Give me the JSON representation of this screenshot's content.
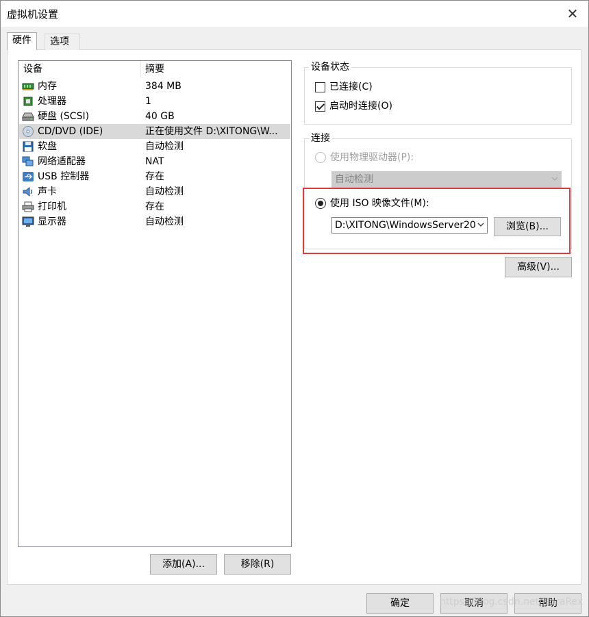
{
  "window": {
    "title": "虚拟机设置",
    "close": "✕"
  },
  "tabs": [
    {
      "label": "硬件",
      "active": true
    },
    {
      "label": "选项",
      "active": false
    }
  ],
  "device_list": {
    "headers": [
      "设备",
      "摘要"
    ],
    "rows": [
      {
        "icon": "memory-icon",
        "name": "内存",
        "summary": "384 MB"
      },
      {
        "icon": "processor-icon",
        "name": "处理器",
        "summary": "1"
      },
      {
        "icon": "hard-disk-icon",
        "name": "硬盘 (SCSI)",
        "summary": "40 GB"
      },
      {
        "icon": "cd-dvd-icon",
        "name": "CD/DVD (IDE)",
        "summary": "正在使用文件 D:\\XITONG\\W...",
        "selected": true
      },
      {
        "icon": "floppy-icon",
        "name": "软盘",
        "summary": "自动检测"
      },
      {
        "icon": "network-adapter-icon",
        "name": "网络适配器",
        "summary": "NAT"
      },
      {
        "icon": "usb-icon",
        "name": "USB 控制器",
        "summary": "存在"
      },
      {
        "icon": "sound-card-icon",
        "name": "声卡",
        "summary": "自动检测"
      },
      {
        "icon": "printer-icon",
        "name": "打印机",
        "summary": "存在"
      },
      {
        "icon": "display-icon",
        "name": "显示器",
        "summary": "自动检测"
      }
    ]
  },
  "list_buttons": {
    "add": "添加(A)...",
    "remove": "移除(R)"
  },
  "device_status": {
    "title": "设备状态",
    "connected": {
      "label": "已连接(C)",
      "checked": false
    },
    "connect_at_power_on": {
      "label": "启动时连接(O)",
      "checked": true
    }
  },
  "connection": {
    "title": "连接",
    "physical_drive": {
      "label": "使用物理驱动器(P):",
      "selected": false,
      "value": "自动检测"
    },
    "iso_image": {
      "label": "使用 ISO 映像文件(M):",
      "selected": true,
      "value": "D:\\XITONG\\WindowsServer20"
    },
    "browse": "浏览(B)...",
    "advanced": "高级(V)..."
  },
  "footer": {
    "ok": "确定",
    "cancel": "取消",
    "help": "帮助"
  },
  "watermark": "https://blog.csdn.net/DoraRex",
  "colors": {
    "highlight": "#e0393e",
    "selected_row": "#d9d9d9",
    "button": "#e1e1e1"
  }
}
